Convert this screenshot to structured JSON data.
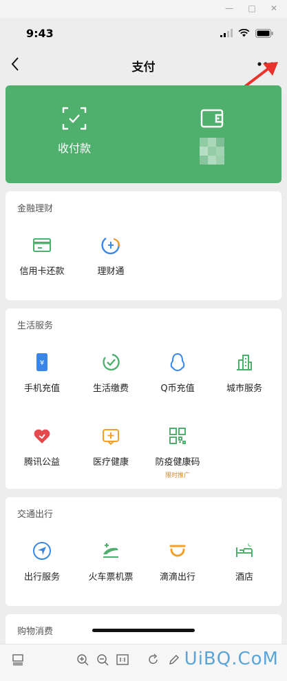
{
  "status": {
    "time": "9:43"
  },
  "nav": {
    "title": "支付"
  },
  "pay_card": {
    "receive_label": "收付款"
  },
  "finance": {
    "title": "金融理财",
    "items": [
      {
        "label": "信用卡还款"
      },
      {
        "label": "理财通"
      }
    ]
  },
  "life": {
    "title": "生活服务",
    "items": [
      {
        "label": "手机充值"
      },
      {
        "label": "生活缴费"
      },
      {
        "label": "Q币充值"
      },
      {
        "label": "城市服务"
      },
      {
        "label": "腾讯公益"
      },
      {
        "label": "医疗健康"
      },
      {
        "label": "防疫健康码",
        "promo": "限时推广"
      }
    ]
  },
  "transport": {
    "title": "交通出行",
    "items": [
      {
        "label": "出行服务"
      },
      {
        "label": "火车票机票"
      },
      {
        "label": "滴滴出行"
      },
      {
        "label": "酒店"
      }
    ]
  },
  "shopping": {
    "title": "购物消费"
  },
  "watermark": "UiBQ.CoM",
  "colors": {
    "brand_green": "#4fb06e",
    "arrow_red": "#e8322b",
    "promo": "#d28a2a"
  }
}
